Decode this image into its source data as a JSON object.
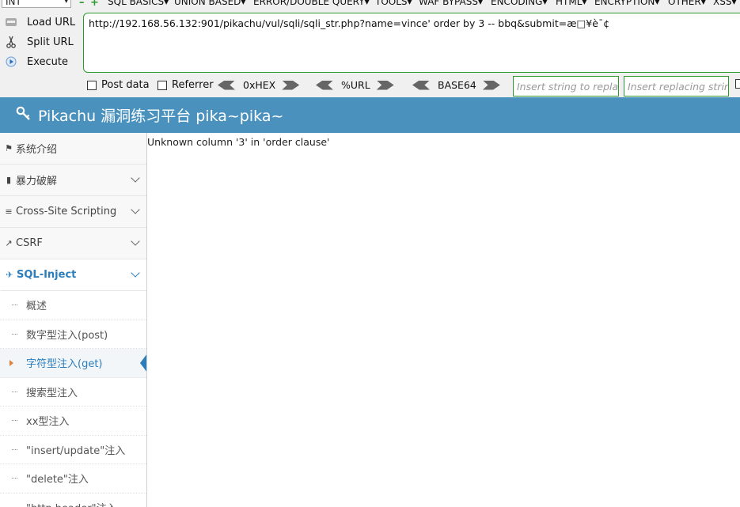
{
  "menubar": {
    "select_value": "INT",
    "items": [
      "SQL BASICS▾",
      "UNION BASED▾",
      "ERROR/DOUBLE QUERY▾",
      "TOOLS▾",
      "WAF BYPASS▾",
      "ENCODING▾",
      "HTML▾",
      "ENCRYPTION▾",
      "OTHER▾",
      "XSS▾"
    ]
  },
  "hackbar": {
    "load_url": "Load URL",
    "split_url": "Split URL",
    "execute": "Execute",
    "url_value": "http://192.168.56.132:901/pikachu/vul/sqli/sqli_str.php?name=vince' order by 3 -- bbq&submit=æ□¥è¯¢",
    "post_data": "Post data",
    "referrer": "Referrer",
    "hex": "0xHEX",
    "url_enc": "%URL",
    "base64": "BASE64",
    "insert_placeholder": "Insert string to replace",
    "replacing_placeholder": "Insert replacing string"
  },
  "header": {
    "title": "Pikachu 漏洞练习平台 pika~pika~"
  },
  "sidebar": {
    "items": [
      {
        "label": "系统介绍"
      },
      {
        "label": "暴力破解"
      },
      {
        "label": "Cross-Site Scripting"
      },
      {
        "label": "CSRF"
      },
      {
        "label": "SQL-Inject"
      }
    ],
    "sub_items": [
      {
        "label": "概述"
      },
      {
        "label": "数字型注入(post)"
      },
      {
        "label": "字符型注入(get)"
      },
      {
        "label": "搜索型注入"
      },
      {
        "label": "xx型注入"
      },
      {
        "label": "\"insert/update\"注入"
      },
      {
        "label": "\"delete\"注入"
      },
      {
        "label": "\"http header\"注入"
      }
    ]
  },
  "main": {
    "error": "Unknown column '3' in 'order clause'"
  },
  "colors": {
    "header_bg": "#4a91bd",
    "accent": "#2b7dbc",
    "hackbar_border": "#2e9a2e"
  }
}
